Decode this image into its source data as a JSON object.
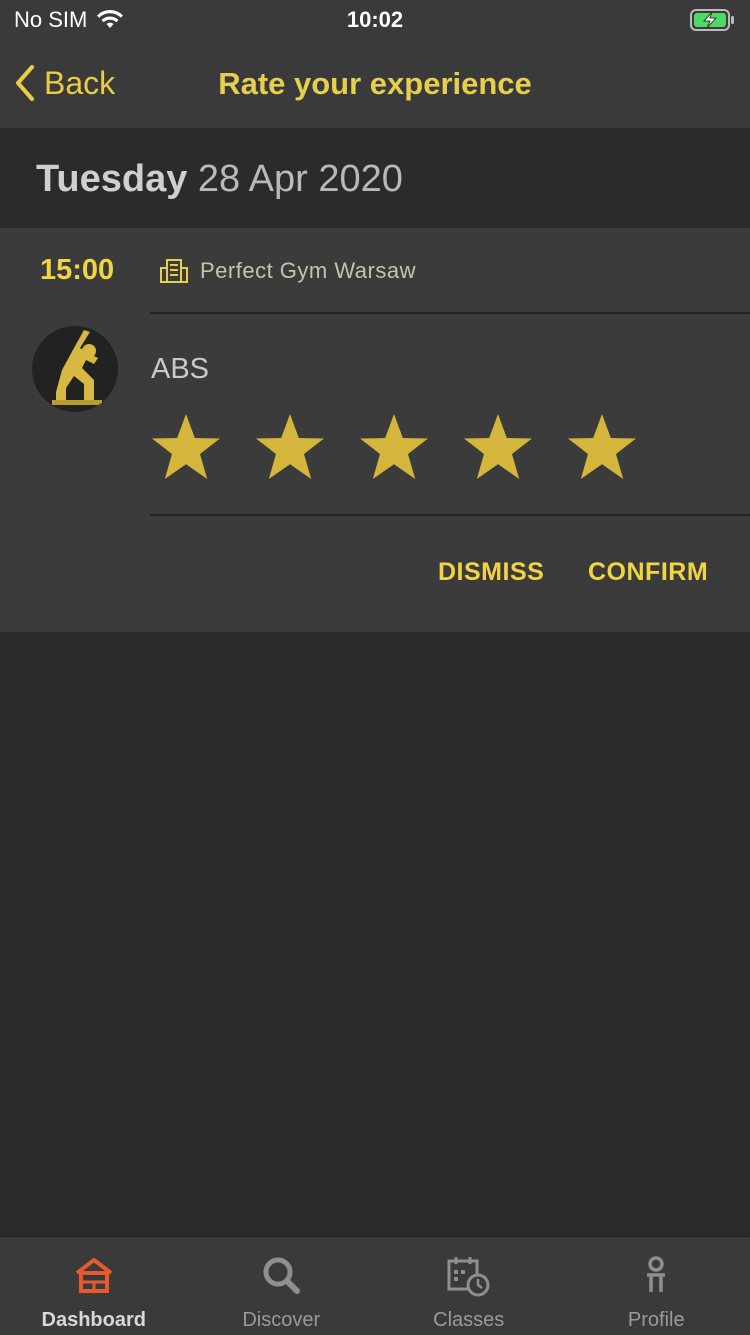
{
  "status_bar": {
    "carrier": "No SIM",
    "time": "10:02"
  },
  "nav": {
    "back_label": "Back",
    "title": "Rate your experience"
  },
  "date": {
    "weekday": "Tuesday",
    "date": "28 Apr 2020"
  },
  "session": {
    "time": "15:00",
    "location": "Perfect Gym Warsaw",
    "class_name": "ABS",
    "rating": 5,
    "max_rating": 5
  },
  "actions": {
    "dismiss_label": "DISMISS",
    "confirm_label": "CONFIRM"
  },
  "tabs": [
    {
      "label": "Dashboard",
      "icon": "house-icon",
      "active": true
    },
    {
      "label": "Discover",
      "icon": "search-icon",
      "active": false
    },
    {
      "label": "Classes",
      "icon": "calendar-clock-icon",
      "active": false
    },
    {
      "label": "Profile",
      "icon": "person-icon",
      "active": false
    }
  ],
  "colors": {
    "accent": "#f1d442",
    "active_tab": "#e85a2c",
    "background": "#2b2b2b"
  }
}
